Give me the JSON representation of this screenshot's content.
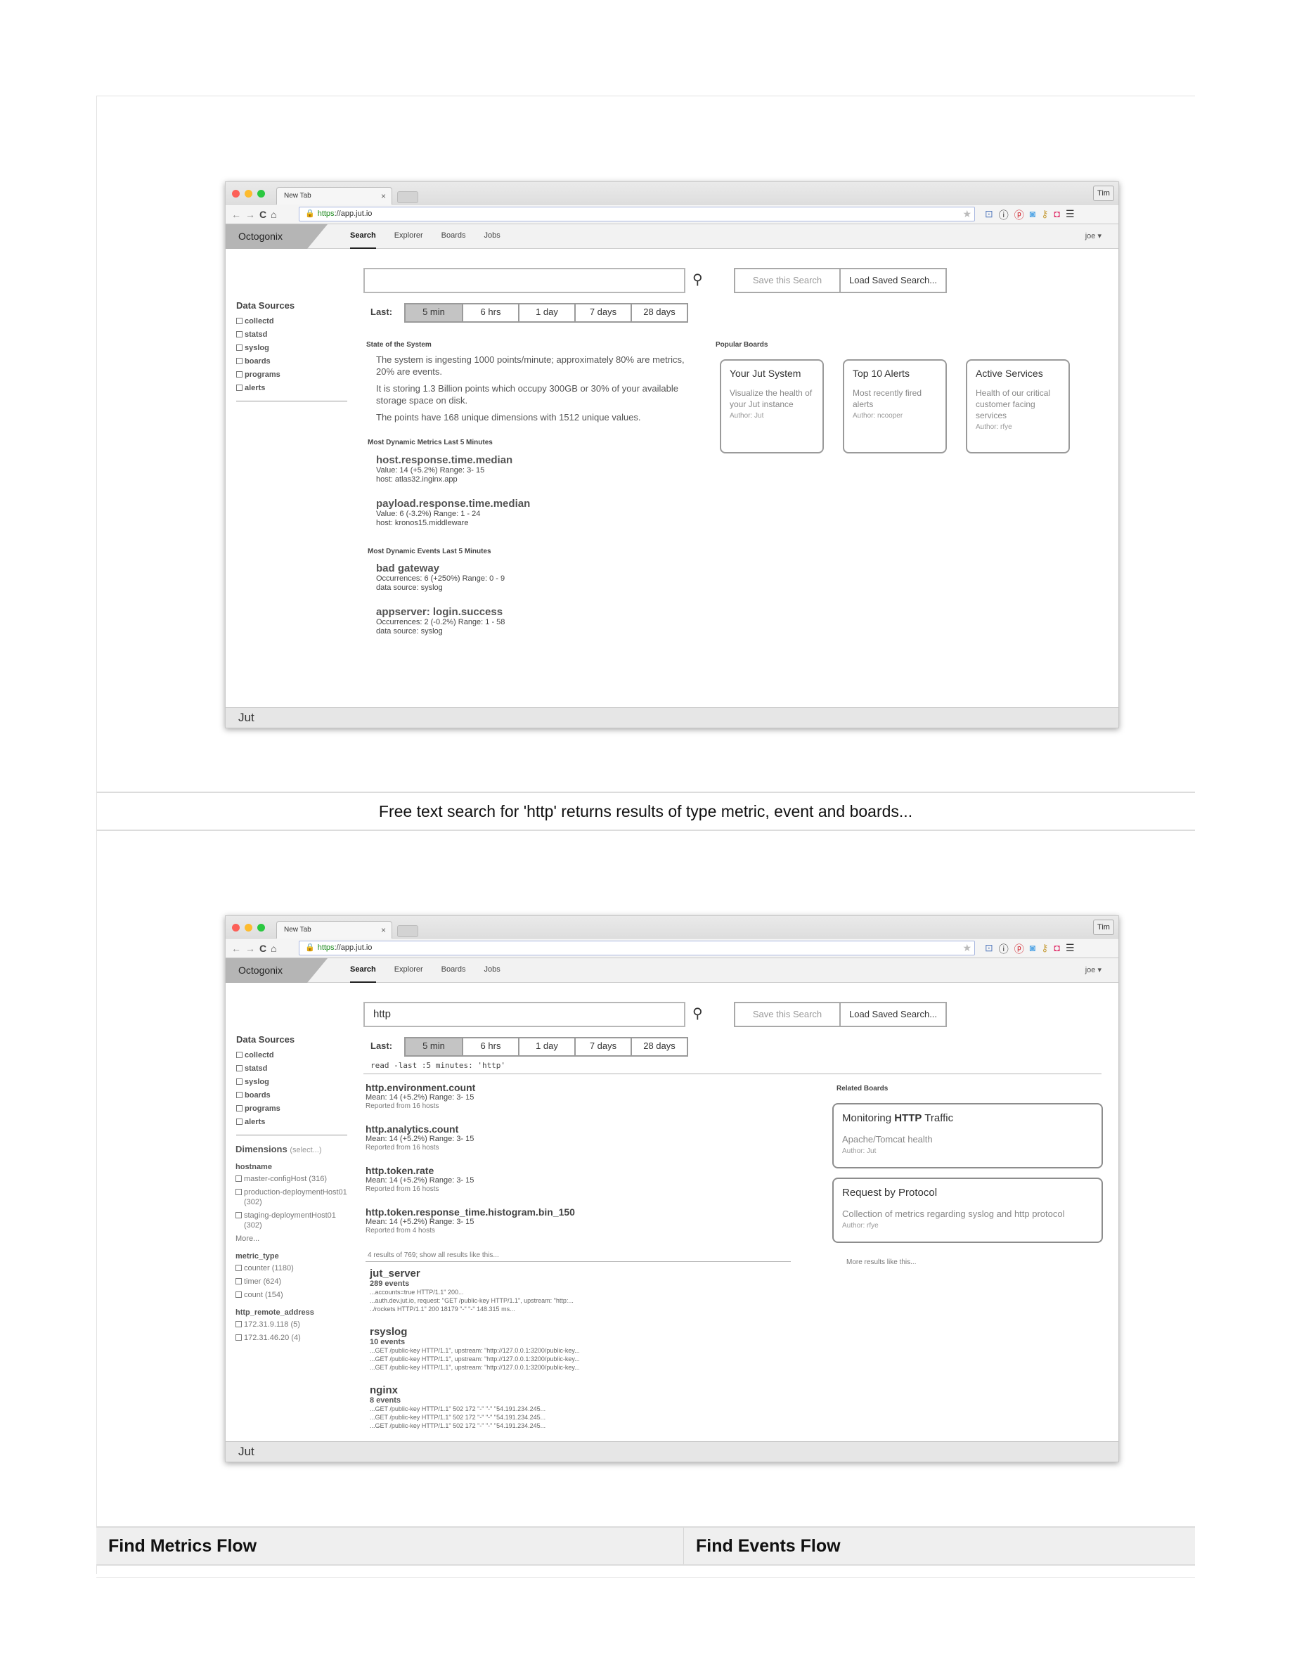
{
  "browser": {
    "tab_title": "New Tab",
    "tab_close": "×",
    "user_button": "Tim",
    "url_scheme": "https",
    "url_rest": "://app.jut.io",
    "nav_back": "←",
    "nav_forward": "→",
    "nav_reload": "C",
    "nav_home": "⌂",
    "ext_icons": [
      "bookmark-icon",
      "info-icon",
      "pinterest-icon",
      "camera-icon",
      "key-icon",
      "screenshot-icon",
      "menu-icon"
    ]
  },
  "app": {
    "brand": "Octogonix",
    "nav": [
      "Search",
      "Explorer",
      "Boards",
      "Jobs"
    ],
    "user_menu": "joe ▾",
    "footer": "Jut",
    "save_search": "Save this Search",
    "load_search": "Load Saved Search...",
    "last_label": "Last:",
    "ranges": [
      "5 min",
      "6 hrs",
      "1 day",
      "7 days",
      "28 days"
    ],
    "data_sources_title": "Data Sources",
    "data_sources": [
      "collectd",
      "statsd",
      "syslog",
      "boards",
      "programs",
      "alerts"
    ]
  },
  "captions": {
    "middle": "Free text search for 'http' returns results of type metric, event and boards...",
    "left_flow": "Find Metrics Flow",
    "right_flow": "Find Events Flow"
  },
  "screen1": {
    "search_value": "",
    "state_title": "State of the System",
    "state_paragraphs": [
      "The system is ingesting 1000 points/minute; approximately 80% are metrics, 20% are events.",
      "It is storing 1.3 Billion points which occupy 300GB or 30% of your available storage space on disk.",
      "The points have 168 unique dimensions with 1512 unique values."
    ],
    "metrics_title": "Most Dynamic Metrics Last 5 Minutes",
    "metrics": [
      {
        "name": "host.response.time.median",
        "line1": "Value: 14 (+5.2%)  Range: 3- 15",
        "line2": "host: atlas32.inginx.app"
      },
      {
        "name": "payload.response.time.median",
        "line1": "Value: 6 (-3.2%) Range: 1 - 24",
        "line2": "host: kronos15.middleware"
      }
    ],
    "events_title": "Most Dynamic Events Last 5 Minutes",
    "events": [
      {
        "name": "bad gateway",
        "line1": "Occurrences: 6 (+250%) Range: 0 - 9",
        "line2": "data source: syslog"
      },
      {
        "name": "appserver: login.success",
        "line1": "Occurrences: 2 (-0.2%) Range: 1 - 58",
        "line2": "data source: syslog"
      }
    ],
    "popular_title": "Popular Boards",
    "boards": [
      {
        "title": "Your Jut System",
        "desc": "Visualize the health of your Jut instance",
        "author": "Author: Jut"
      },
      {
        "title": "Top 10 Alerts",
        "desc": "Most recently fired alerts",
        "author": "Author: ncooper"
      },
      {
        "title": "Active Services",
        "desc": "Health of our critical customer facing services",
        "author": "Author: rfye"
      }
    ]
  },
  "screen2": {
    "search_value": "http",
    "command": "read -last :5 minutes: 'http'",
    "dimensions_title": "Dimensions",
    "dimensions_select": "(select...)",
    "dimension_groups": [
      {
        "name": "hostname",
        "options": [
          "master-configHost (316)",
          "production-deploymentHost01 (302)",
          "staging-deploymentHost01 (302)"
        ],
        "more": "More..."
      },
      {
        "name": "metric_type",
        "options": [
          "counter (1180)",
          "timer (624)",
          "count (154)"
        ],
        "more": ""
      },
      {
        "name": "http_remote_address",
        "options": [
          "172.31.9.118 (5)",
          "172.31.46.20 (4)"
        ],
        "more": ""
      }
    ],
    "metric_results": [
      {
        "name": "http.environment.count",
        "line1": "Mean: 14 (+5.2%)    Range: 3- 15",
        "line2": "Reported from 16 hosts"
      },
      {
        "name": "http.analytics.count",
        "line1": "Mean: 14 (+5.2%)    Range: 3- 15",
        "line2": "Reported from 16 hosts"
      },
      {
        "name": "http.token.rate",
        "line1": "Mean: 14 (+5.2%)    Range: 3- 15",
        "line2": "Reported from 16 hosts"
      },
      {
        "name": "http.token.response_time.histogram.bin_150",
        "line1": "Mean: 14 (+5.2%)    Range: 3- 15",
        "line2": "Reported from 4 hosts"
      }
    ],
    "results_summary": "4 results of 769; show all results like this...",
    "event_results": [
      {
        "name": "jut_server",
        "count": "289 events",
        "lines": [
          "...accounts=true HTTP/1.1\" 200...",
          "...auth.dev.jut.io, request: \"GET /public-key HTTP/1.1\", upstream: \"http:...",
          "../rockets HTTP/1.1\" 200 18179 \"-\" \"-\" 148.315 ms..."
        ]
      },
      {
        "name": "rsyslog",
        "count": "10 events",
        "lines": [
          "...GET /public-key HTTP/1.1\", upstream: \"http://127.0.0.1:3200/public-key...",
          "...GET /public-key HTTP/1.1\", upstream: \"http://127.0.0.1:3200/public-key...",
          "...GET /public-key HTTP/1.1\", upstream: \"http://127.0.0.1:3200/public-key..."
        ]
      },
      {
        "name": "nginx",
        "count": "8 events",
        "lines": [
          "...GET /public-key HTTP/1.1\" 502 172 \"-\" \"-\" \"54.191.234.245...",
          "...GET /public-key HTTP/1.1\" 502 172 \"-\" \"-\" \"54.191.234.245...",
          "...GET /public-key HTTP/1.1\" 502 172 \"-\" \"-\" \"54.191.234.245..."
        ]
      }
    ],
    "related_title": "Related Boards",
    "related_boards": [
      {
        "title_pre": "Monitoring ",
        "title_bold": "HTTP",
        "title_post": " Traffic",
        "desc": "Apache/Tomcat health",
        "author": "Author: Jut"
      },
      {
        "title_pre": "Request by Protocol",
        "title_bold": "",
        "title_post": "",
        "desc": "Collection of metrics regarding syslog and http protocol",
        "author": "Author: rfye"
      }
    ],
    "more_results": "More results like this..."
  }
}
